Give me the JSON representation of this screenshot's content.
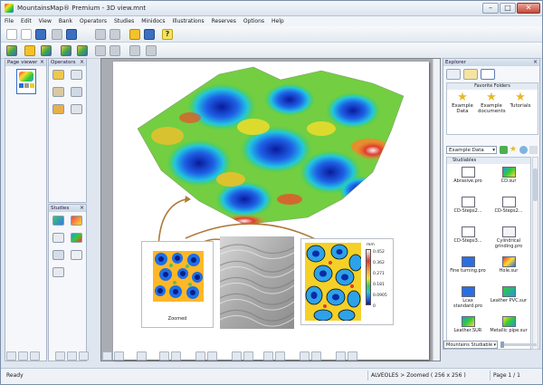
{
  "window": {
    "title": "MountainsMap® Premium - 3D view.mnt"
  },
  "menu": [
    "File",
    "Edit",
    "View",
    "Bank",
    "Operators",
    "Studies",
    "Minidocs",
    "Illustrations",
    "Reserves",
    "Options",
    "Help"
  ],
  "panels": {
    "page_viewer": {
      "title": "Page viewer"
    },
    "operators": {
      "title": "Operators"
    },
    "studies": {
      "title": "Studies"
    },
    "explorer": {
      "title": "Explorer"
    }
  },
  "explorer": {
    "favorites_header": "Favorite Folders",
    "favorites": [
      "Example Data",
      "Example documents",
      "Tutorials"
    ],
    "folder_select": "Example Data",
    "studiables_header": "Studiables",
    "items": [
      "Abrasive.pro",
      "CD.sur",
      "CD-Steps2...",
      "CD-Steps2...",
      "CD-Steps3...",
      "Cylindrical grinding.pro",
      "Fine turning.pro",
      "Hole.sur",
      "Lcax standard.pro",
      "Leather PVC.sur",
      "Leather.SUR",
      "Metallic pipe.sur"
    ],
    "filter_select": "Mountains Studiable"
  },
  "document": {
    "zoomed_caption": "Zoomed",
    "colorbar_unit": "mm",
    "colorbar_ticks": [
      "0.452",
      "0.362",
      "0.271",
      "0.181",
      "0.0905",
      "0"
    ]
  },
  "status": {
    "left": "Ready",
    "center": "ALVEOLES > Zoomed ( 256 x 256 )",
    "page": "Page 1 / 1"
  }
}
